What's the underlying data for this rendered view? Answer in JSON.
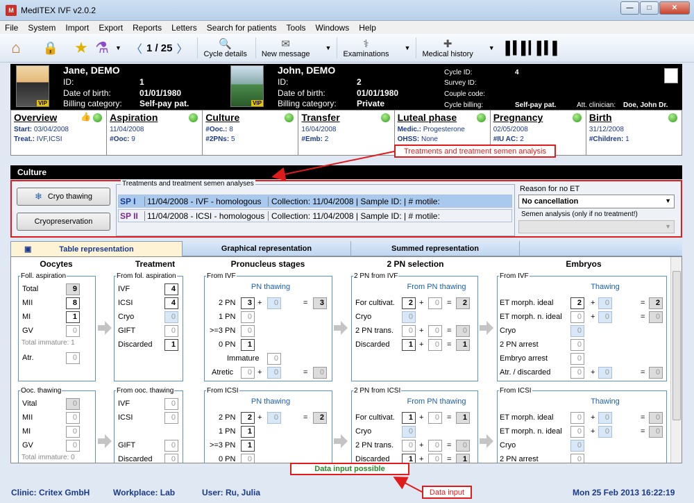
{
  "window": {
    "title": "MedITEX IVF v2.0.2",
    "minimize": "—",
    "maximize": "□",
    "close": "✕"
  },
  "menu": [
    "File",
    "System",
    "Import",
    "Export",
    "Reports",
    "Letters",
    "Search for patients",
    "Tools",
    "Windows",
    "Help"
  ],
  "toolbar": {
    "counter": "1 / 25",
    "cycle_details": "Cycle details",
    "new_message": "New message",
    "examinations": "Examinations",
    "medical_history": "Medical history"
  },
  "patient_female": {
    "name": "Jane, DEMO",
    "id_label": "ID:",
    "id": "1",
    "dob_label": "Date of birth:",
    "dob": "01/01/1980",
    "billing_label": "Billing category:",
    "billing": "Self-pay pat.",
    "vip": "VIP"
  },
  "patient_male": {
    "name": "John, DEMO",
    "id_label": "ID:",
    "id": "2",
    "dob_label": "Date of birth:",
    "dob": "01/01/1980",
    "billing_label": "Billing category:",
    "billing": "Private",
    "vip": "VIP"
  },
  "cycle": {
    "cycle_id_label": "Cycle ID:",
    "cycle_id": "4",
    "survey_id_label": "Survey ID:",
    "couple_code_label": "Couple code:",
    "cycle_billing_label": "Cycle billing:",
    "cycle_billing": "Self-pay pat.",
    "clinician_label": "Att. clinician:",
    "clinician": "Doe, John Dr."
  },
  "phases": [
    {
      "title": "Overview",
      "line1_label": "Start:",
      "line1": "03/04/2008",
      "line2_label": "Treat.:",
      "line2": "IVF,ICSI"
    },
    {
      "title": "Aspiration",
      "line1_label": "",
      "line1": "11/04/2008",
      "line2_label": "#Ooc:",
      "line2": "9"
    },
    {
      "title": "Culture",
      "line1_label": "#Ooc.:",
      "line1": "8",
      "line2_label": "#2PNs:",
      "line2": "5"
    },
    {
      "title": "Transfer",
      "line1_label": "",
      "line1": "16/04/2008",
      "line2_label": "#Emb:",
      "line2": "2"
    },
    {
      "title": "Luteal phase",
      "line1_label": "Medic.:",
      "line1": "Progesterone",
      "line2_label": "OHSS:",
      "line2": "None"
    },
    {
      "title": "Pregnancy",
      "line1_label": "",
      "line1": "02/05/2008",
      "line2_label": "#IU AC:",
      "line2": "2"
    },
    {
      "title": "Birth",
      "line1_label": "",
      "line1": "31/12/2008",
      "line2_label": "#Children:",
      "line2": "1"
    }
  ],
  "callouts": {
    "treatments": "Treatments and treatment semen analysis",
    "data_input": "Data input",
    "data_input_possible": "Data input possible"
  },
  "culture": {
    "header": "Culture",
    "cryo_thawing": "Cryo thawing",
    "cryopreservation": "Cryopreservation",
    "group_label": "Treatments and treatment semen analyses",
    "rows": [
      {
        "sp": "SP I",
        "treatment": "11/04/2008 - IVF - homologous",
        "info": "Collection: 11/04/2008 | Sample ID:  | # motile:"
      },
      {
        "sp": "SP II",
        "treatment": "11/04/2008 - ICSI - homologous",
        "info": "Collection: 11/04/2008 | Sample ID:  | # motile:"
      }
    ],
    "reason_label": "Reason for no ET",
    "reason_value": "No cancellation",
    "semen_label": "Semen analysis (only if no treatment!)"
  },
  "tabs": [
    "Table representation",
    "Graphical representation",
    "Summed representation"
  ],
  "columns": {
    "oocytes": "Oocytes",
    "treatment": "Treatment",
    "pronucleus": "Pronucleus stages",
    "pn_selection": "2 PN selection",
    "embryos": "Embryos"
  },
  "oocytes_top": {
    "group": "Foll. aspiration",
    "total_label": "Total",
    "total": "9",
    "mii_label": "MII",
    "mii": "8",
    "mi_label": "MI",
    "mi": "1",
    "gv_label": "GV",
    "gv": "0",
    "immature": "Total immature: 1",
    "atr_label": "Atr.",
    "atr": "0"
  },
  "oocytes_bot": {
    "group": "Ooc. thawing",
    "vital_label": "Vital",
    "vital": "0",
    "mii_label": "MII",
    "mii": "0",
    "mi_label": "MI",
    "mi": "0",
    "gv_label": "GV",
    "gv": "0",
    "immature": "Total immature: 0"
  },
  "treat_top": {
    "group": "From fol. aspiration",
    "ivf_label": "IVF",
    "ivf": "4",
    "icsi_label": "ICSI",
    "icsi": "4",
    "cryo_label": "Cryo",
    "cryo": "0",
    "gift_label": "GIFT",
    "gift": "0",
    "disc_label": "Discarded",
    "disc": "1"
  },
  "treat_bot": {
    "group": "From ooc. thawing",
    "ivf_label": "IVF",
    "ivf": "0",
    "icsi_label": "ICSI",
    "icsi": "0",
    "gift_label": "GIFT",
    "gift": "0",
    "disc_label": "Discarded",
    "disc": "0"
  },
  "pn_top": {
    "group": "From IVF",
    "sub": "PN thawing",
    "pn2_label": "2 PN",
    "pn2": "3",
    "pn2_thaw": "0",
    "pn2_sum": "3",
    "pn1_label": "1 PN",
    "pn1": "0",
    "pn3_label": ">=3 PN",
    "pn3": "0",
    "pn0_label": "0 PN",
    "pn0": "1",
    "imm_label": "Immature",
    "imm": "0",
    "atr_label": "Atretic",
    "atr": "0",
    "atr_thaw": "0",
    "atr_sum": "0"
  },
  "pn_bot": {
    "group": "From ICSI",
    "sub": "PN thawing",
    "pn2_label": "2 PN",
    "pn2": "2",
    "pn2_thaw": "0",
    "pn2_sum": "2",
    "pn1_label": "1 PN",
    "pn1": "1",
    "pn3_label": ">=3 PN",
    "pn3": "1",
    "pn0_label": "0 PN",
    "pn0": "0"
  },
  "sel_top": {
    "group": "2 PN from IVF",
    "sub": "From PN thawing",
    "cult_label": "For cultivat.",
    "cult": "2",
    "cult_thaw": "0",
    "cult_sum": "2",
    "cryo_label": "Cryo",
    "cryo": "0",
    "trans_label": "2 PN trans.",
    "trans": "0",
    "trans_thaw": "0",
    "trans_sum": "0",
    "disc_label": "Discarded",
    "disc": "1",
    "disc_thaw": "0",
    "disc_sum": "1"
  },
  "sel_bot": {
    "group": "2 PN from ICSI",
    "sub": "From PN thawing",
    "cult_label": "For cultivat.",
    "cult": "1",
    "cult_thaw": "0",
    "cult_sum": "1",
    "cryo_label": "Cryo",
    "cryo": "0",
    "trans_label": "2 PN trans.",
    "trans": "0",
    "trans_thaw": "0",
    "trans_sum": "0",
    "disc_label": "Discarded",
    "disc": "1",
    "disc_thaw": "0",
    "disc_sum": "1"
  },
  "emb_top": {
    "group": "From IVF",
    "sub": "Thawing",
    "ideal_label": "ET morph. ideal",
    "ideal": "2",
    "ideal_thaw": "0",
    "ideal_sum": "2",
    "nideal_label": "ET morph. n. ideal",
    "nideal": "0",
    "nideal_thaw": "0",
    "nideal_sum": "0",
    "cryo_label": "Cryo",
    "cryo": "0",
    "arrest_label": "2 PN arrest",
    "arrest": "0",
    "earrest_label": "Embryo arrest",
    "earrest": "0",
    "atr_label": "Atr. / discarded",
    "atr": "0",
    "atr_thaw": "0",
    "atr_sum": "0"
  },
  "emb_bot": {
    "group": "From ICSI",
    "sub": "Thawing",
    "ideal_label": "ET morph. ideal",
    "ideal": "0",
    "ideal_thaw": "0",
    "ideal_sum": "0",
    "nideal_label": "ET morph. n. ideal",
    "nideal": "0",
    "nideal_thaw": "0",
    "nideal_sum": "0",
    "cryo_label": "Cryo",
    "cryo": "0",
    "arrest_label": "2 PN arrest",
    "arrest": "0"
  },
  "status": {
    "clinic": "Clinic: Critex GmbH",
    "workplace": "Workplace: Lab",
    "user": "User: Ru, Julia",
    "datetime": "Mon 25 Feb 2013 16:22:19"
  },
  "colors": {
    "accent_red": "#e01b1b",
    "phase_green": "#2c9a1c",
    "link_blue": "#1a3a8a"
  }
}
